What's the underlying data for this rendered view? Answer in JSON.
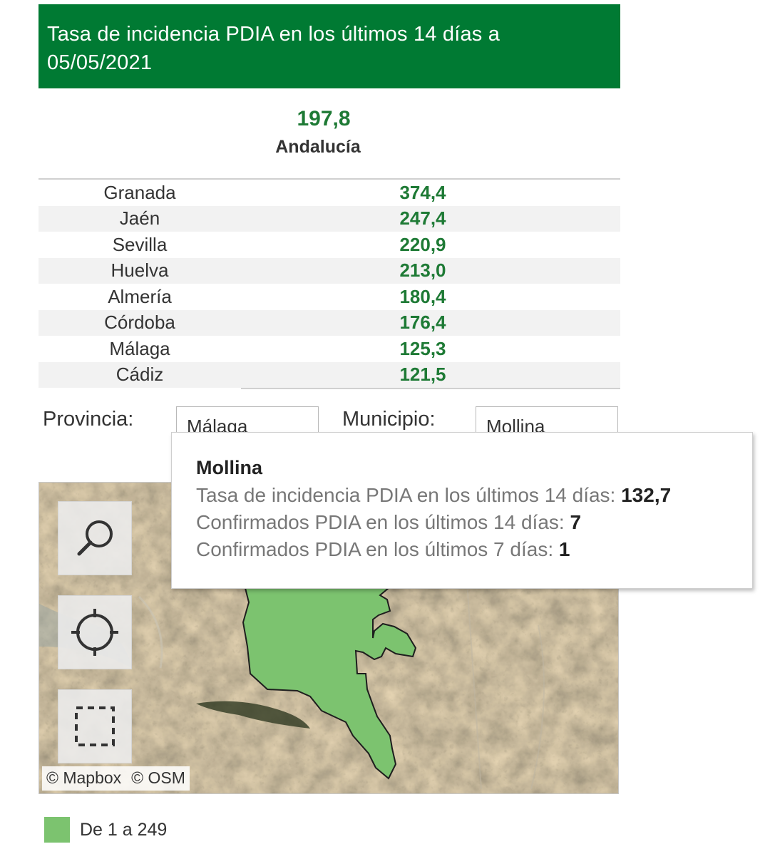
{
  "header": {
    "title": "Tasa de incidencia PDIA en los últimos 14 días a 05/05/2021"
  },
  "summary": {
    "value": "197,8",
    "region": "Andalucía"
  },
  "provinces": [
    {
      "name": "Granada",
      "value": "374,4"
    },
    {
      "name": "Jaén",
      "value": "247,4"
    },
    {
      "name": "Sevilla",
      "value": "220,9"
    },
    {
      "name": "Huelva",
      "value": "213,0"
    },
    {
      "name": "Almería",
      "value": "180,4"
    },
    {
      "name": "Córdoba",
      "value": "176,4"
    },
    {
      "name": "Málaga",
      "value": "125,3"
    },
    {
      "name": "Cádiz",
      "value": "121,5"
    }
  ],
  "filters": {
    "provincia_label": "Provincia:",
    "provincia_value": "Málaga",
    "municipio_label": "Municipio:",
    "municipio_value": "Mollina"
  },
  "map": {
    "buttons": [
      "search-icon",
      "locate-icon",
      "select-area-icon"
    ],
    "attribution_mapbox": "© Mapbox",
    "attribution_osm": "© OSM",
    "region_color": "#7cc36f"
  },
  "tooltip": {
    "title": "Mollina",
    "rate_label": "Tasa de incidencia PDIA en los últimos 14 días:",
    "rate_value": "132,7",
    "confirmed14_label": "Confirmados PDIA en los últimos 14 días:",
    "confirmed14_value": "7",
    "confirmed7_label": "Confirmados PDIA en los últimos 7 días:",
    "confirmed7_value": "1"
  },
  "legend": {
    "label": "De 1 a 249",
    "color": "#7cc36f"
  },
  "colors": {
    "header_bg": "#007a33",
    "value_green": "#1e7a35"
  }
}
